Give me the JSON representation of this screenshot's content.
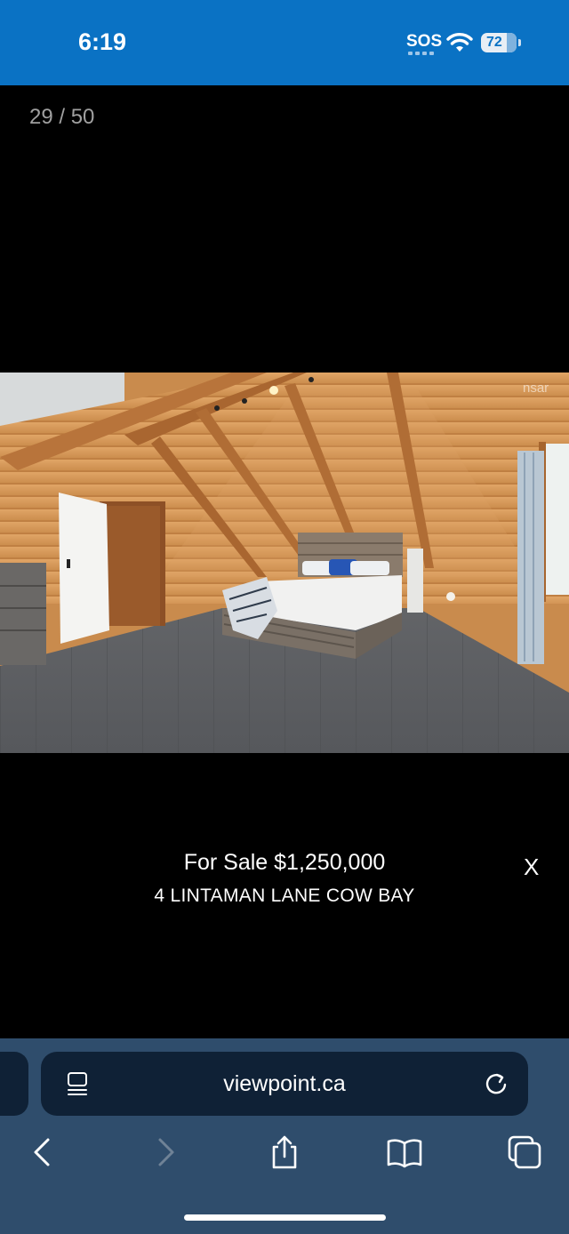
{
  "status": {
    "time": "6:19",
    "carrier": "SOS",
    "battery": "72"
  },
  "gallery": {
    "counter": "29 / 50",
    "image_alt": "Bedroom with wood-paneled vaulted ceiling, bed, dresser and gray hardwood floor",
    "watermark": "nsar",
    "price": "For Sale $1,250,000",
    "address": "4 LINTAMAN LANE COW BAY",
    "close": "X"
  },
  "browser": {
    "url": "viewpoint.ca"
  },
  "colors": {
    "status_bar": "#0a72c4",
    "toolbar": "#2f4d6c",
    "pill": "#0f2136"
  }
}
